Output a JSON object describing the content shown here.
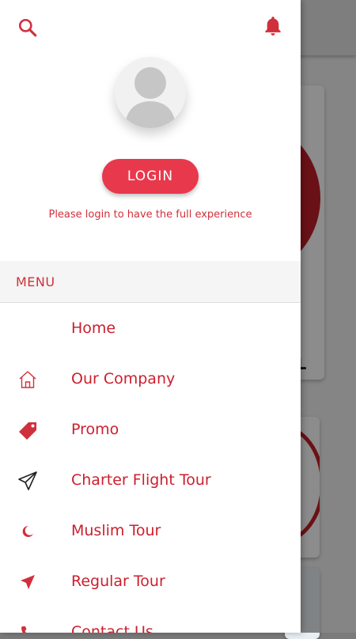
{
  "header": {
    "search_icon": "search-icon",
    "notification_icon": "bell-icon"
  },
  "profile": {
    "avatar_icon": "default-user-avatar",
    "login_label": "LOGIN",
    "login_hint": "Please login to have the full experience"
  },
  "menu": {
    "title": "MENU",
    "items": [
      {
        "label": "Home",
        "icon": "none"
      },
      {
        "label": "Our Company",
        "icon": "house-outline-icon"
      },
      {
        "label": "Promo",
        "icon": "tag-icon"
      },
      {
        "label": "Charter Flight Tour",
        "icon": "paper-plane-outline-icon"
      },
      {
        "label": "Muslim Tour",
        "icon": "crescent-moon-icon"
      },
      {
        "label": "Regular Tour",
        "icon": "paper-plane-filled-icon"
      },
      {
        "label": "Contact Us",
        "icon": "phone-icon"
      }
    ]
  },
  "colors": {
    "accent": "#e8384c",
    "text_accent": "#cc1f2e",
    "icon_red": "#d0303c"
  }
}
